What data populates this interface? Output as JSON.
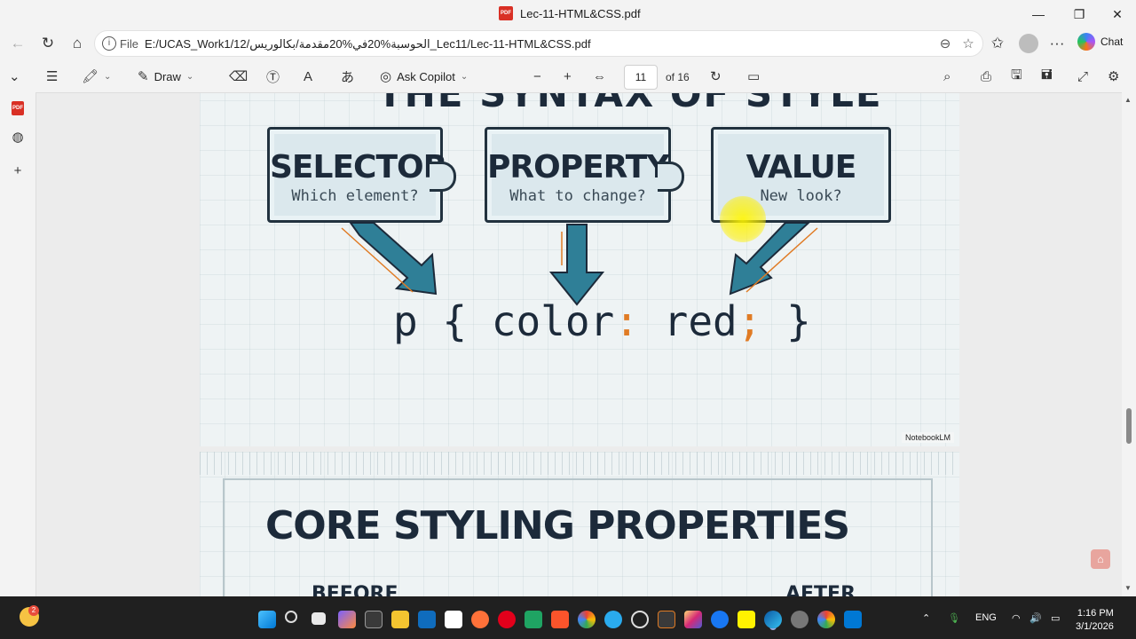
{
  "window": {
    "title": "Lec-11-HTML&CSS.pdf",
    "minimize_glyph": "—",
    "restore_glyph": "❐",
    "close_glyph": "✕"
  },
  "address": {
    "scheme_label": "File",
    "url": "E:/UCAS_Work1/12/الحوسبة%20في%20مقدمة/بكالوريس_Lec11/Lec-11-HTML&CSS.pdf",
    "chat_label": "Chat"
  },
  "pdf_toolbar": {
    "draw_label": "Draw",
    "ask_copilot_label": "Ask Copilot",
    "page_current": "11",
    "page_of": "of 16"
  },
  "slide1": {
    "title": "THE SYNTAX OF STYLE",
    "pieces": [
      {
        "label": "SELECTOR",
        "hint": "Which element?"
      },
      {
        "label": "PROPERTY",
        "hint": "What to change?"
      },
      {
        "label": "VALUE",
        "hint": "New look?"
      }
    ],
    "code": {
      "p1": "p { color",
      "colon": ":",
      "p2": " red",
      "semi": ";",
      "p3": " }"
    },
    "watermark": "NotebookLM"
  },
  "slide2": {
    "title": "CORE STYLING PROPERTIES",
    "before_label": "BEFORE",
    "after_label": "AFTER"
  },
  "taskbar": {
    "weather_badge": "2",
    "language": "ENG",
    "time": "1:16 PM",
    "date": "3/1/2026"
  },
  "colors": {
    "accent_orange": "#e07b24",
    "ink": "#1c2a3a",
    "arrow_teal": "#2f7f97"
  }
}
